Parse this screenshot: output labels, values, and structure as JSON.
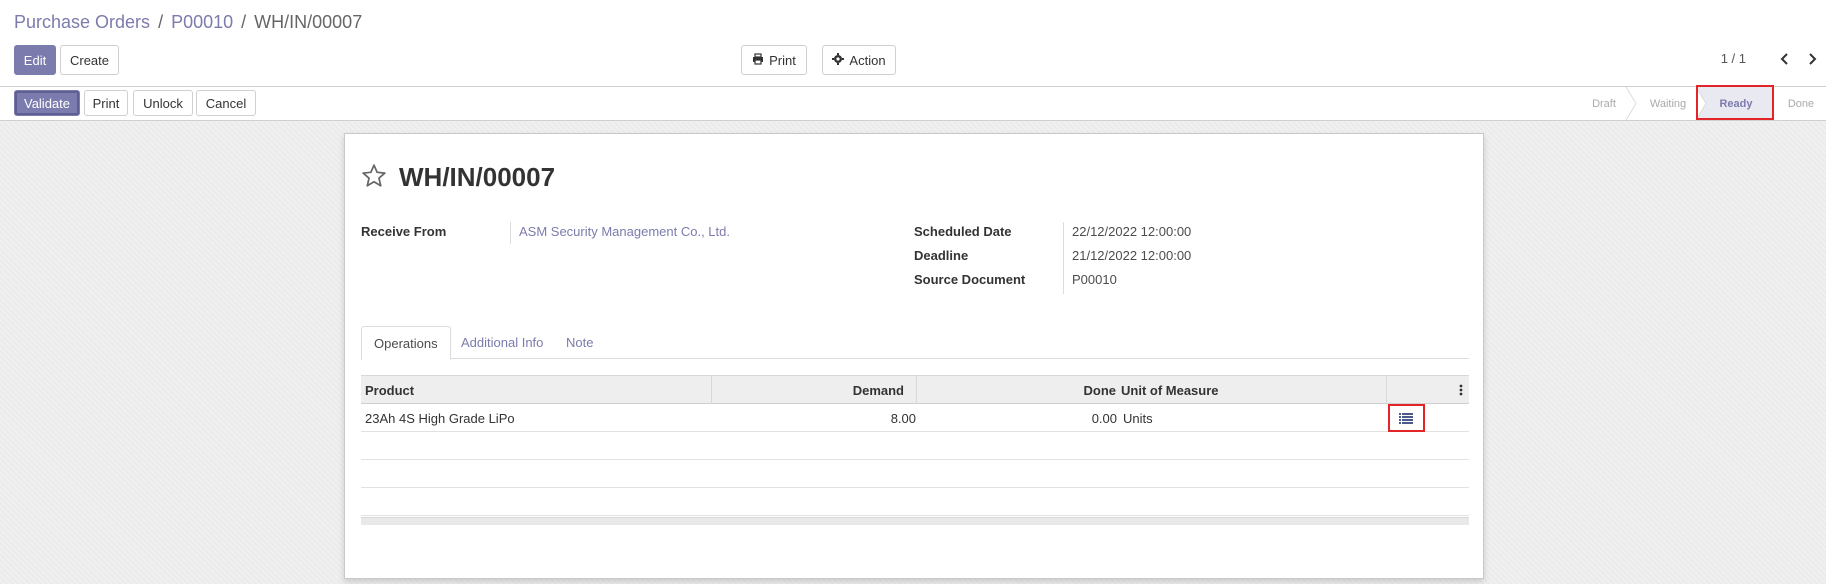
{
  "breadcrumb": {
    "items": [
      "Purchase Orders",
      "P00010",
      "WH/IN/00007"
    ],
    "separator": "/"
  },
  "toolbar": {
    "edit_label": "Edit",
    "create_label": "Create",
    "print_label": "Print",
    "action_label": "Action"
  },
  "pager": {
    "value": "1 / 1"
  },
  "statusbar": {
    "validate_label": "Validate",
    "print_label": "Print",
    "unlock_label": "Unlock",
    "cancel_label": "Cancel",
    "stages": [
      "Draft",
      "Waiting",
      "Ready",
      "Done"
    ],
    "active_stage": "Ready"
  },
  "record": {
    "title": "WH/IN/00007",
    "receive_from_label": "Receive From",
    "receive_from_value": "ASM Security Management Co., Ltd.",
    "scheduled_date_label": "Scheduled Date",
    "scheduled_date_value": "22/12/2022 12:00:00",
    "deadline_label": "Deadline",
    "deadline_value": "21/12/2022 12:00:00",
    "source_document_label": "Source Document",
    "source_document_value": "P00010"
  },
  "tabs": [
    "Operations",
    "Additional Info",
    "Note"
  ],
  "table": {
    "headers": [
      "Product",
      "Demand",
      "Done",
      "Unit of Measure"
    ],
    "rows": [
      {
        "product": "23Ah 4S High Grade LiPo",
        "demand": "8.00",
        "done": "0.00",
        "uom": "Units"
      }
    ]
  },
  "colors": {
    "primary": "#7c7bad",
    "highlight": "#e3252a"
  },
  "icons": [
    "print-icon",
    "gear-icon",
    "chevron-left-icon",
    "chevron-right-icon",
    "star-icon",
    "kebab-icon",
    "list-detail-icon"
  ]
}
